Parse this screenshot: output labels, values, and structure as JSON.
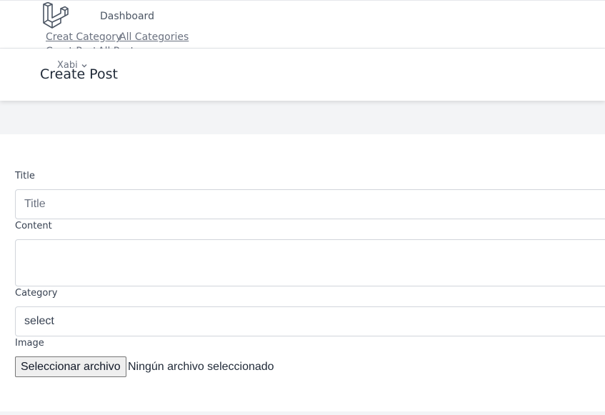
{
  "nav": {
    "dashboard": "Dashboard",
    "links": [
      "Creat Category",
      "All Categories",
      "Creat Post",
      "All Posts"
    ],
    "user": "Xabi"
  },
  "header": {
    "title": "Create Post"
  },
  "form": {
    "title_label": "Title",
    "title_placeholder": "Title",
    "content_label": "Content",
    "category_label": "Category",
    "category_value": "select",
    "image_label": "Image",
    "file_button": "Seleccionar archivo",
    "file_status": "Ningún archivo seleccionado"
  }
}
